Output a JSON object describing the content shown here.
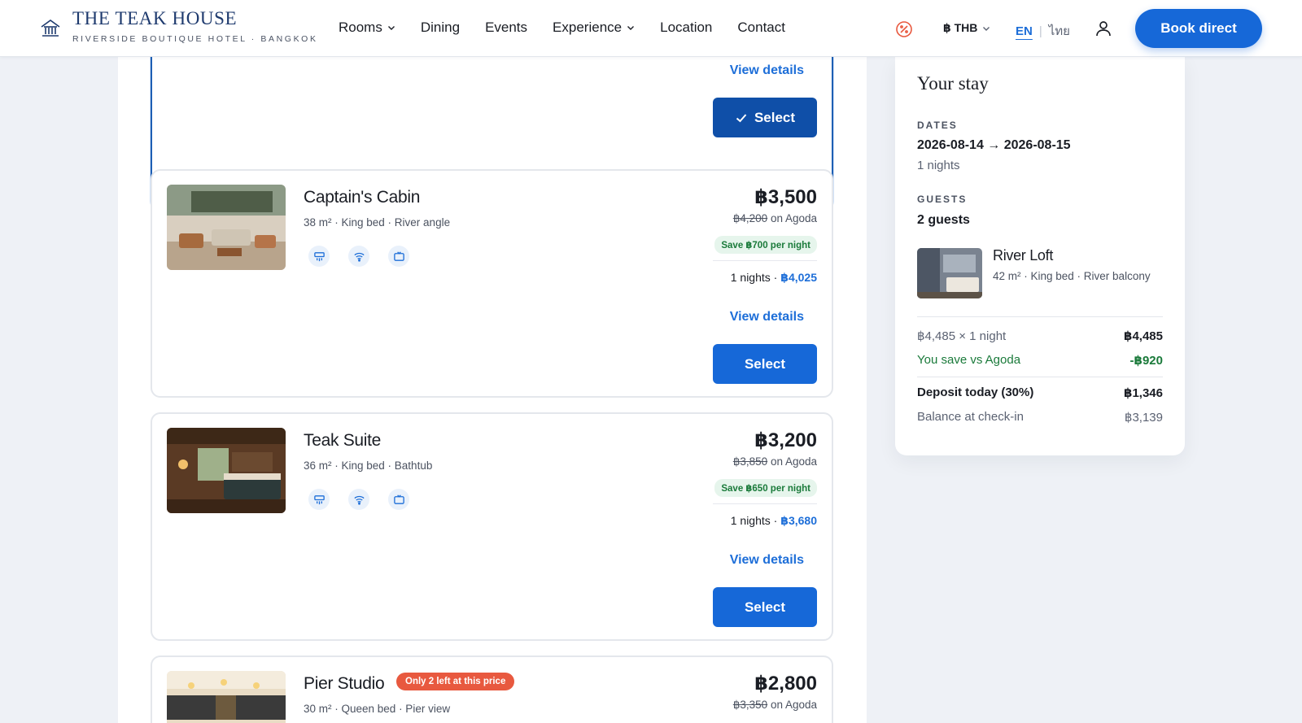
{
  "header": {
    "brand_title": "THE TEAK HOUSE",
    "brand_subtitle": "RIVERSIDE BOUTIQUE HOTEL · BANGKOK",
    "nav": [
      {
        "label": "Rooms",
        "has_menu": true
      },
      {
        "label": "Dining",
        "has_menu": false
      },
      {
        "label": "Events",
        "has_menu": false
      },
      {
        "label": "Experience",
        "has_menu": true
      },
      {
        "label": "Location",
        "has_menu": false
      },
      {
        "label": "Contact",
        "has_menu": false
      }
    ],
    "currency": "฿ THB",
    "lang_en": "EN",
    "lang_th": "ไทย",
    "book_label": "Book direct"
  },
  "selected_card": {
    "view_details": "View details",
    "select_label": "Select"
  },
  "rooms": [
    {
      "name": "Captain's Cabin",
      "meta": "38 m² · King bed · River angle",
      "price": "฿3,500",
      "ota_price": "฿4,200",
      "ota_suffix": " on Agoda",
      "save": "Save ฿700 per night",
      "nights_label": "1 nights · ",
      "nights_total": "฿4,025",
      "view_details": "View details",
      "select_label": "Select"
    },
    {
      "name": "Teak Suite",
      "meta": "36 m² · King bed · Bathtub",
      "price": "฿3,200",
      "ota_price": "฿3,850",
      "ota_suffix": " on Agoda",
      "save": "Save ฿650 per night",
      "nights_label": "1 nights · ",
      "nights_total": "฿3,680",
      "view_details": "View details",
      "select_label": "Select"
    },
    {
      "name": "Pier Studio",
      "badge": "Only 2 left at this price",
      "meta": "30 m² · Queen bed · Pier view",
      "price": "฿2,800",
      "ota_price": "฿3,350",
      "ota_suffix": " on Agoda"
    }
  ],
  "summary": {
    "title": "Your stay",
    "dates_label": "DATES",
    "dates_value": "2026-08-14 → 2026-08-15",
    "nights": "1 nights",
    "guests_label": "GUESTS",
    "guests_value": "2 guests",
    "room_name": "River Loft",
    "room_meta": "42 m² · King bed · River balcony",
    "line_label": "฿4,485 × 1 night",
    "line_value": "฿4,485",
    "save_label": "You save vs Agoda",
    "save_value": "-฿920",
    "deposit_label": "Deposit today (30%)",
    "deposit_value": "฿1,346",
    "balance_label": "Balance at check-in",
    "balance_value": "฿3,139"
  },
  "colors": {
    "accent": "#1668d8",
    "brand_navy": "#1e3a6e",
    "save_green": "#1a7a3a",
    "badge_red": "#e8593f"
  }
}
